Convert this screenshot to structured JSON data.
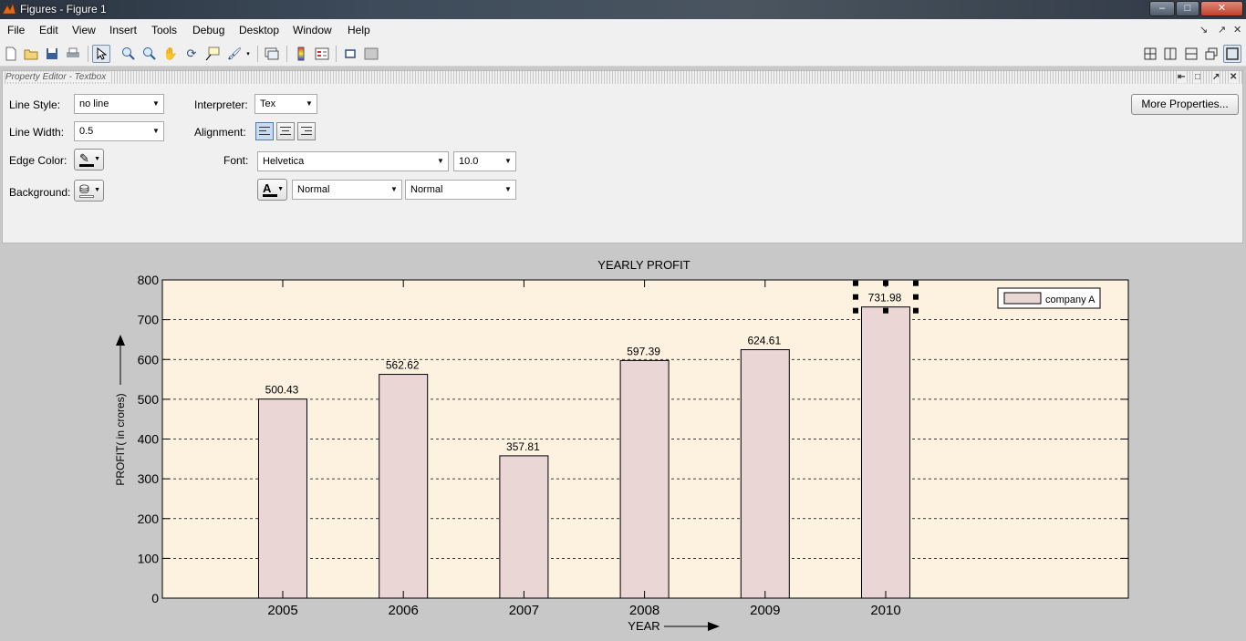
{
  "window": {
    "title": "Figures - Figure 1",
    "buttons": [
      "–",
      "□",
      "✕"
    ]
  },
  "menubar": {
    "items": [
      "File",
      "Edit",
      "View",
      "Insert",
      "Tools",
      "Debug",
      "Desktop",
      "Window",
      "Help"
    ],
    "right_controls": [
      "↘",
      "↗",
      "✕"
    ]
  },
  "property_editor": {
    "header": "Property Editor - Textbox",
    "header_controls": [
      "⇤",
      "□",
      "↗",
      "✕"
    ],
    "line_style_label": "Line Style:",
    "line_style_value": "no line",
    "line_width_label": "Line Width:",
    "line_width_value": "0.5",
    "edge_color_label": "Edge Color:",
    "background_label": "Background:",
    "interpreter_label": "Interpreter:",
    "interpreter_value": "Tex",
    "alignment_label": "Alignment:",
    "font_label": "Font:",
    "font_name_value": "Helvetica",
    "font_size_value": "10.0",
    "font_weight_value": "Normal",
    "font_angle_value": "Normal",
    "more_properties_label": "More Properties..."
  },
  "chart_data": {
    "type": "bar",
    "title": "YEARLY PROFIT",
    "xlabel": "YEAR",
    "ylabel": "PROFIT( in crores)",
    "categories": [
      "2005",
      "2006",
      "2007",
      "2008",
      "2009",
      "2010"
    ],
    "series": [
      {
        "name": "company A",
        "values": [
          500.43,
          562.62,
          357.81,
          597.39,
          624.61,
          731.98
        ]
      }
    ],
    "data_labels": [
      "500.43",
      "562.62",
      "357.81",
      "597.39",
      "624.61",
      "731.98"
    ],
    "y_ticks": [
      "0",
      "100",
      "200",
      "300",
      "400",
      "500",
      "600",
      "700",
      "800"
    ],
    "ylim": [
      0,
      800
    ],
    "grid": "horizontal dashed",
    "legend_position": "top-right",
    "colors": {
      "axes_background": "#fdf1df",
      "bar_fill": "#ebd6d6",
      "figure_background": "#c8c8c8"
    },
    "selected_label": "731.98"
  }
}
